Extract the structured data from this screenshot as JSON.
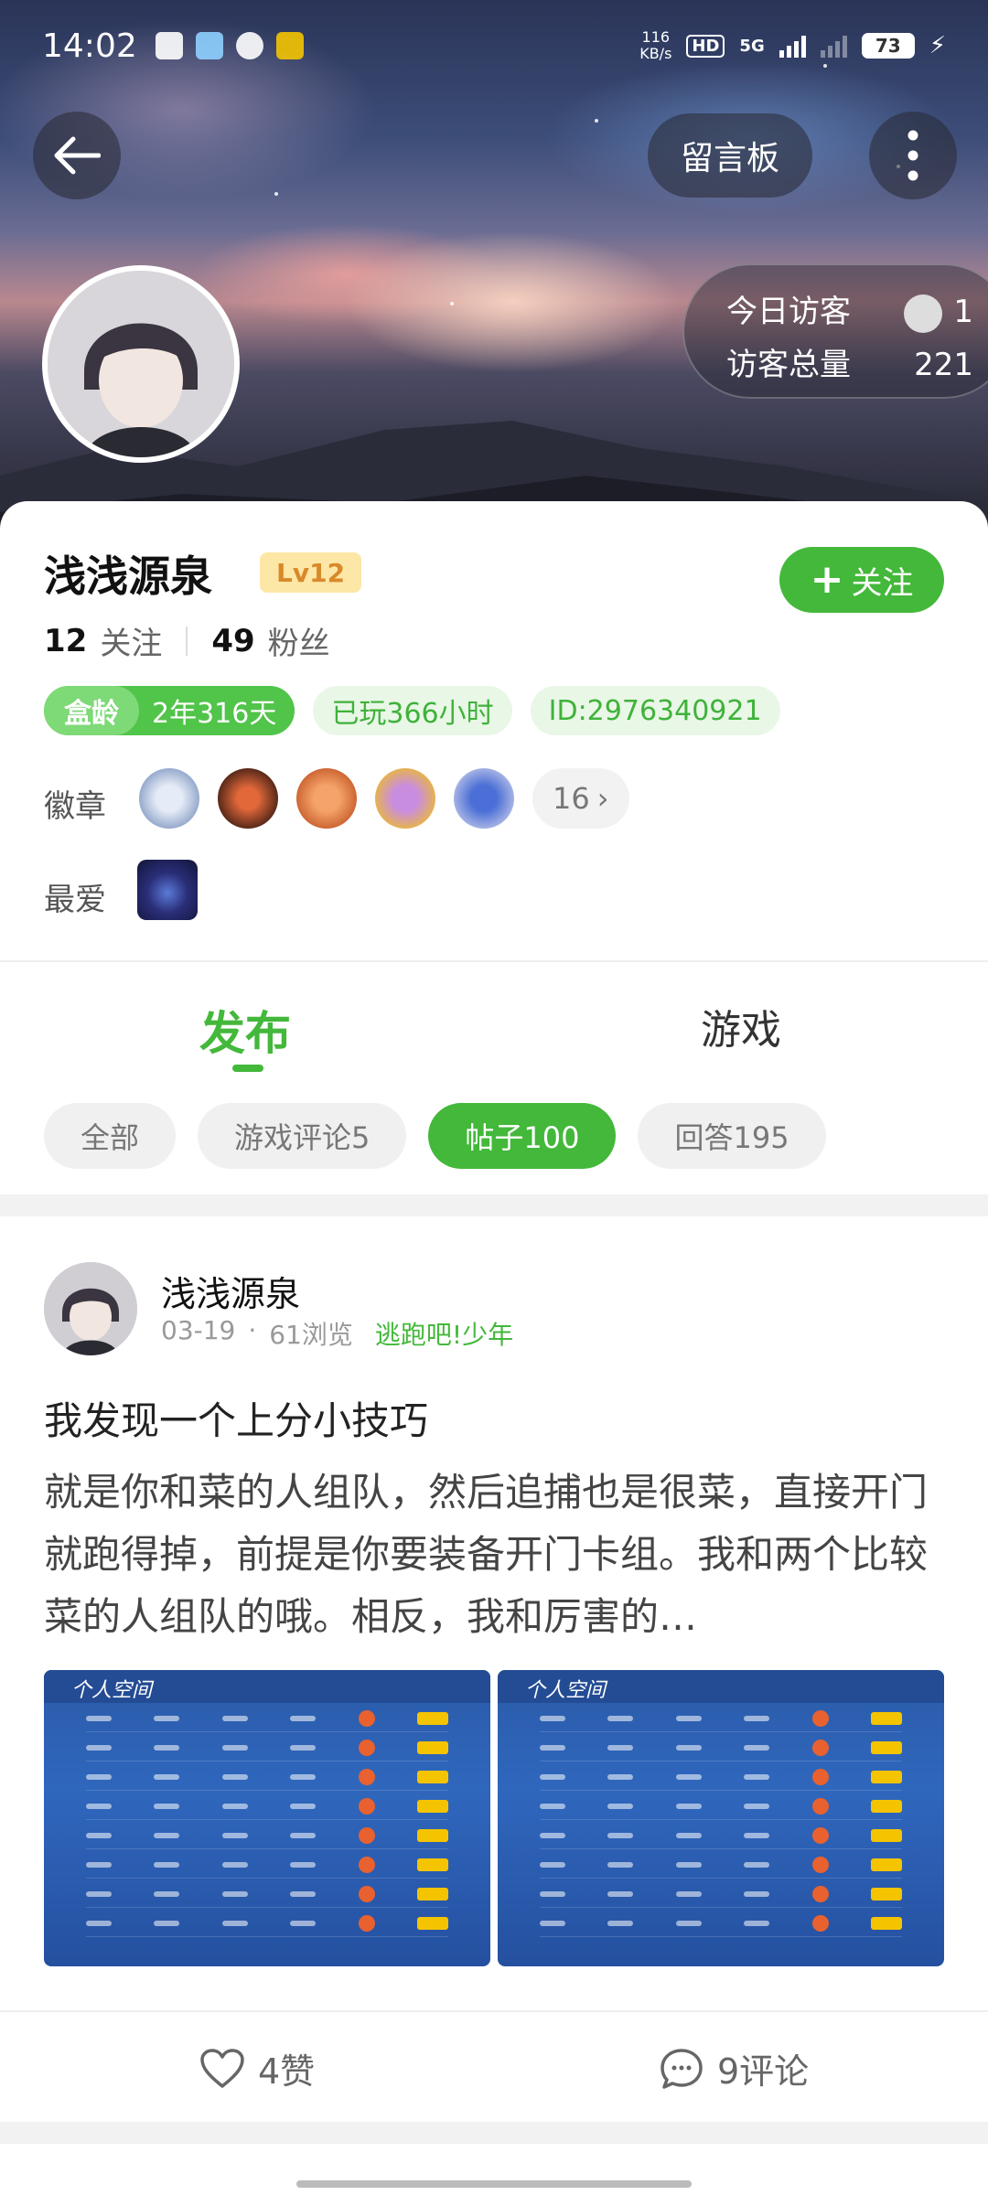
{
  "status_bar": {
    "time": "14:02",
    "net_speed_value": "116",
    "net_speed_unit": "KB/s",
    "hd": "HD",
    "network": "5G",
    "battery": "73"
  },
  "header": {
    "guestbook_label": "留言板",
    "visitors_today_label": "今日访客",
    "visitors_today_value": "1",
    "visitors_total_label": "访客总量",
    "visitors_total_value": "221"
  },
  "profile": {
    "name": "浅浅源泉",
    "level": "Lv12",
    "follow_button": "关注",
    "following_count": "12",
    "following_label": "关注",
    "fans_count": "49",
    "fans_label": "粉丝",
    "tags": {
      "age_label": "盒龄",
      "age_value": "2年316天",
      "played": "已玩366小时",
      "id": "ID:2976340921"
    },
    "badges_label": "徽章",
    "badges_more": "16",
    "favorites_label": "最爱"
  },
  "tabs": {
    "main": [
      "发布",
      "游戏"
    ],
    "filters": [
      "全部",
      "游戏评论5",
      "帖子100",
      "回答195"
    ]
  },
  "post": {
    "author": "浅浅源泉",
    "date": "03-19",
    "views": "61浏览",
    "game": "逃跑吧!少年",
    "title": "我发现一个上分小技巧",
    "body": "就是你和菜的人组队，然后追捕也是很菜，直接开门就跑得掉，前提是你要装备开门卡组。我和两个比较菜的人组队的哦。相反，我和厉害的…",
    "thumb1_title": "个人空间",
    "thumb2_title": "个人空间",
    "likes": "4赞",
    "comments": "9评论"
  },
  "colors": {
    "accent": "#43b83a",
    "level_bg": "#fde7a6",
    "level_text": "#d9892a"
  }
}
